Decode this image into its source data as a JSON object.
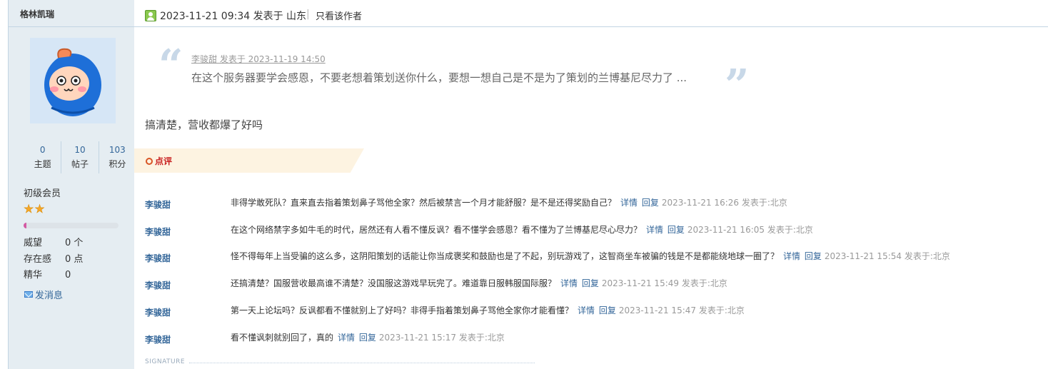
{
  "author": {
    "name": "格林凯瑞",
    "stats": [
      {
        "value": "0",
        "label": "主题"
      },
      {
        "value": "10",
        "label": "帖子"
      },
      {
        "value": "103",
        "label": "积分"
      }
    ],
    "level": "初级会员",
    "stars": 2,
    "progress_percent": 3,
    "props": [
      {
        "key": "威望",
        "value": "0 个"
      },
      {
        "key": "存在感",
        "value": "0 点"
      },
      {
        "key": "精华",
        "value": "0"
      }
    ],
    "send_message": "发消息"
  },
  "post": {
    "time": "2023-11-21 09:34 发表于 山东",
    "separator": "|",
    "only_author": "只看该作者",
    "quote": {
      "meta": "李骏甜 发表于 2023-11-19 14:50",
      "text": "在这个服务器要学会感恩，不要老想着策划送你什么，要想一想自己是不是为了策划的兰博基尼尽力了 ..."
    },
    "body": "搞清楚，营收都爆了好吗"
  },
  "comments_section": {
    "label": "点评",
    "items": [
      {
        "user": "李骏甜",
        "text": "非得学敢死队？直来直去指着策划鼻子骂他全家？然后被禁言一个月才能舒服？是不是还得奖励自己？",
        "detail": "详情",
        "reply": "回复",
        "meta": "2023-11-21 16:26 发表于:北京"
      },
      {
        "user": "李骏甜",
        "text": "在这个网络禁字多如牛毛的时代，居然还有人看不懂反讽？看不懂学会感恩？看不懂为了兰博基尼尽心尽力？",
        "detail": "详情",
        "reply": "回复",
        "meta": "2023-11-21 16:05 发表于:北京"
      },
      {
        "user": "李骏甜",
        "text": "怪不得每年上当受骗的这么多，这阴阳策划的话能让你当成褒奖和鼓励也是了不起，别玩游戏了，这智商坐车被骗的钱是不是都能绕地球一圈了？",
        "detail": "详情",
        "reply": "回复",
        "meta": "2023-11-21 15:54 发表于:北京"
      },
      {
        "user": "李骏甜",
        "text": "还搞清楚？国服营收最高谁不清楚？没国服这游戏早玩完了。难道靠日服韩服国际服？",
        "detail": "详情",
        "reply": "回复",
        "meta": "2023-11-21 15:49 发表于:北京"
      },
      {
        "user": "李骏甜",
        "text": "第一天上论坛吗？反讽都看不懂就别上了好吗？非得手指着策划鼻子骂他全家你才能看懂？",
        "detail": "详情",
        "reply": "回复",
        "meta": "2023-11-21 15:47 发表于:北京"
      },
      {
        "user": "李骏甜",
        "text": "看不懂讽刺就别回了，真的",
        "detail": "详情",
        "reply": "回复",
        "meta": "2023-11-21 15:17 发表于:北京"
      }
    ]
  },
  "signature_label": "SIGNATURE",
  "colors": {
    "link": "#336699",
    "sidebar_bg": "#e5edf2",
    "accent_red": "#c81e1e"
  }
}
